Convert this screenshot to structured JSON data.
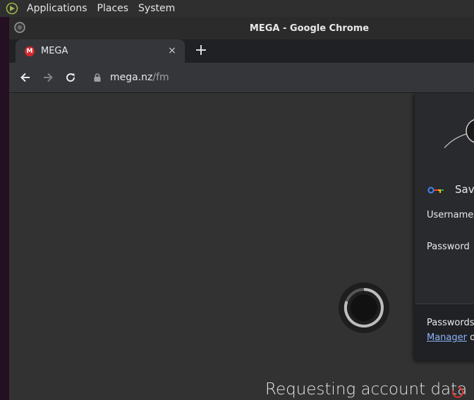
{
  "system_panel": {
    "menus": [
      "Applications",
      "Places",
      "System"
    ]
  },
  "window": {
    "title": "MEGA - Google Chrome"
  },
  "tab": {
    "title": "MEGA",
    "favicon_letter": "M",
    "close_glyph": "×"
  },
  "new_tab_glyph": "+",
  "address_bar": {
    "host": "mega.nz",
    "path": "/fm"
  },
  "page": {
    "status_text": "Requesting account data"
  },
  "password_bubble": {
    "heading": "Save",
    "username_label": "Username",
    "password_label": "Password",
    "footer_line1": "Passwords a",
    "footer_link": "Manager",
    "footer_line2_rest": " on"
  },
  "colors": {
    "mega_red": "#d9272e",
    "link": "#8ab4f8",
    "status_spinner": "#e0312f"
  }
}
